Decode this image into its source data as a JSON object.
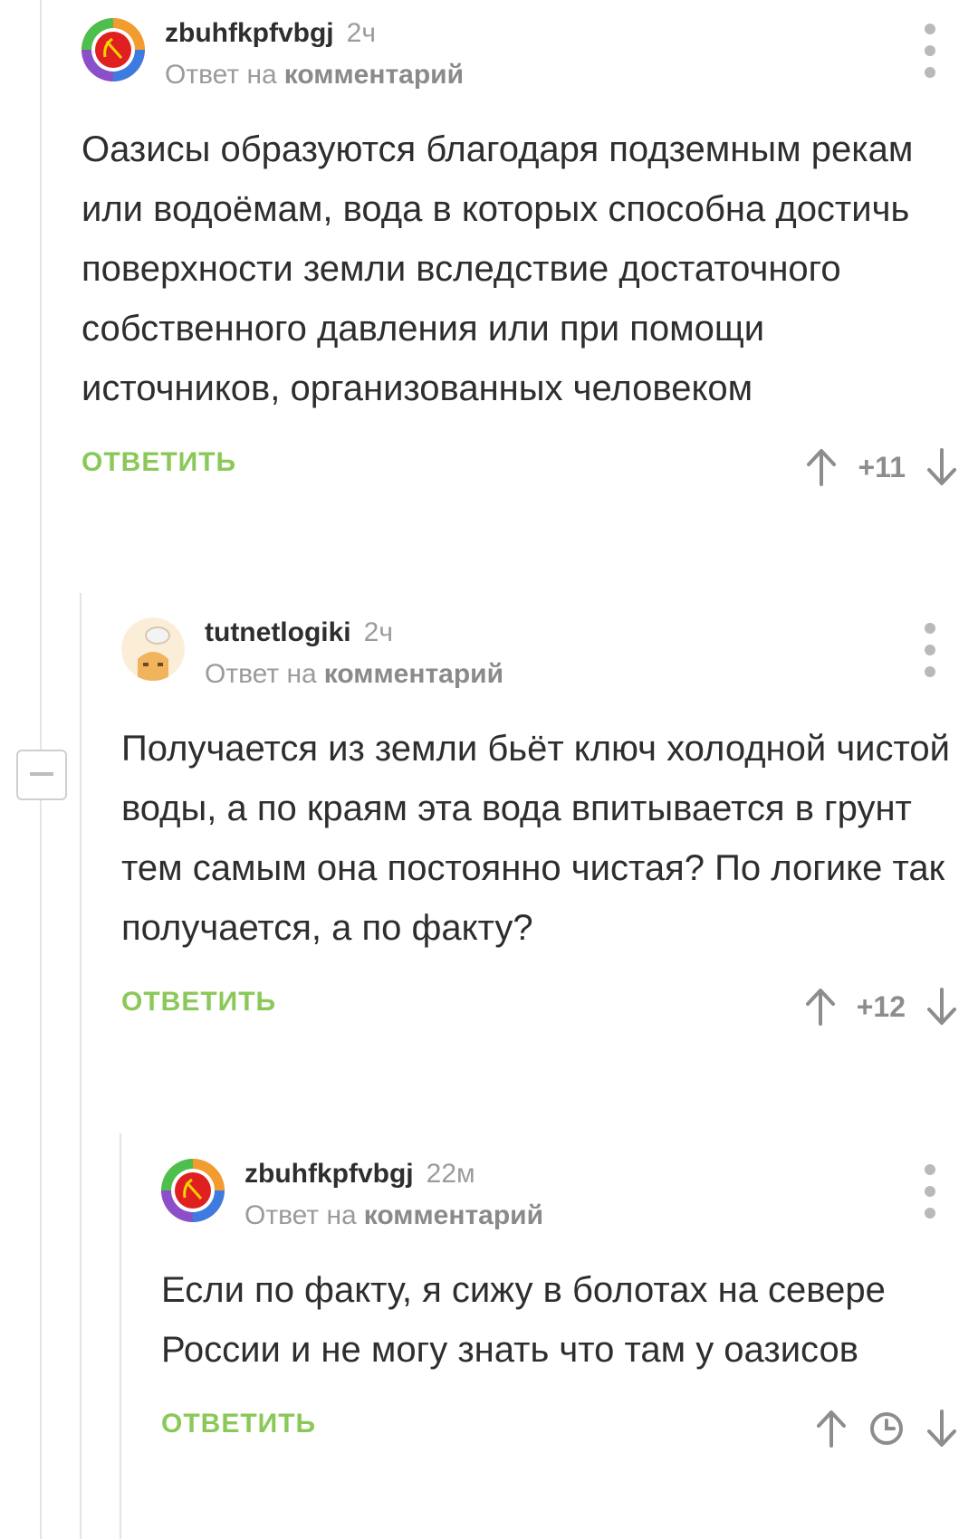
{
  "comments": [
    {
      "username": "zbuhfkpfvbgj",
      "time": "2ч",
      "reply_prefix": "Ответ на",
      "reply_target": "комментарий",
      "text": "Оазисы образуются благодаря подземным рекам или водоёмам, вода в которых способна достичь поверхности земли вследствие достаточного собственного давления или при помощи источников, организованных человеком",
      "reply_label": "ОТВЕТИТЬ",
      "rating": "+11",
      "avatar_icon": "hammer-sickle-rainbow-icon"
    },
    {
      "username": "tutnetlogiki",
      "time": "2ч",
      "reply_prefix": "Ответ на",
      "reply_target": "комментарий",
      "text": "Получается из земли бьёт ключ холодной чистой воды, а по краям эта вода впитывается в грунт тем самым она постоянно чистая? По логике так получается, а по факту?",
      "reply_label": "ОТВЕТИТЬ",
      "rating": "+12",
      "avatar_icon": "peeking-face-icon"
    },
    {
      "username": "zbuhfkpfvbgj",
      "time": "22м",
      "reply_prefix": "Ответ на",
      "reply_target": "комментарий",
      "text": "Если по факту, я сижу в болотах на севере России и не могу знать что там у оазисов",
      "reply_label": "ОТВЕТИТЬ",
      "rating_icon": "clock-icon",
      "avatar_icon": "hammer-sickle-rainbow-icon"
    }
  ],
  "colors": {
    "accent_green": "#8ac858",
    "meta_gray": "#9b9b9b",
    "text": "#2e2e2e",
    "thread_line": "#e4e4e4"
  }
}
